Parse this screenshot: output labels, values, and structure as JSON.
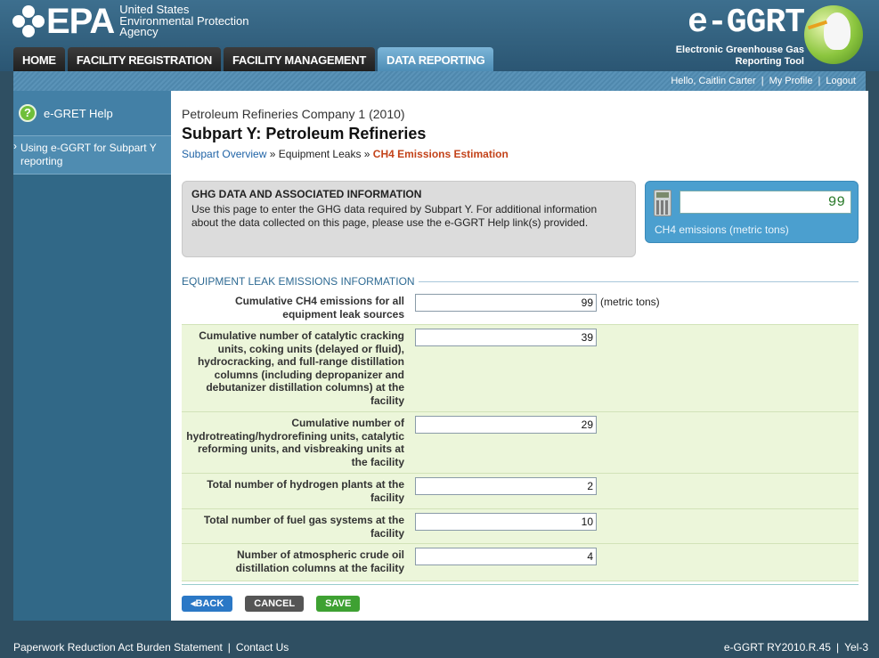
{
  "header": {
    "epa_word": "EPA",
    "agency_lines": [
      "United States",
      "Environmental Protection",
      "Agency"
    ],
    "eggrt_word": "e-GGRT",
    "eggrt_sub": [
      "Electronic Greenhouse Gas",
      "Reporting Tool"
    ]
  },
  "nav": {
    "tabs": [
      {
        "label": "HOME",
        "active": false
      },
      {
        "label": "FACILITY REGISTRATION",
        "active": false
      },
      {
        "label": "FACILITY MANAGEMENT",
        "active": false
      },
      {
        "label": "DATA REPORTING",
        "active": true
      }
    ]
  },
  "userbar": {
    "greeting": "Hello, Caitlin Carter",
    "profile": "My Profile",
    "logout": "Logout",
    "separator": "|"
  },
  "sidebar": {
    "help_title": "e-GRET Help",
    "help_link": "Using e-GGRT for Subpart Y reporting"
  },
  "main": {
    "company": "Petroleum Refineries Company 1 (2010)",
    "title": "Subpart Y: Petroleum Refineries",
    "breadcrumb": {
      "link1": "Subpart Overview",
      "sep": " » ",
      "item2": "Equipment Leaks",
      "current": "CH4 Emissions Estimation"
    },
    "info": {
      "title": "GHG DATA AND ASSOCIATED INFORMATION",
      "text": "Use this page to enter the GHG data required by Subpart Y. For additional information about the data collected on this page, please use the e-GGRT Help link(s) provided."
    },
    "calc": {
      "value": "99",
      "label": "CH4 emissions (metric tons)"
    },
    "section_title": "EQUIPMENT LEAK EMISSIONS INFORMATION",
    "rows": [
      {
        "label": "Cumulative CH4 emissions for all equipment leak sources",
        "value": "99",
        "unit": "(metric tons)"
      },
      {
        "label": "Cumulative number of catalytic cracking units, coking units (delayed or fluid), hydrocracking, and full-range distillation columns (including depropanizer and debutanizer distillation columns) at the facility",
        "value": "39",
        "unit": ""
      },
      {
        "label": "Cumulative number of hydrotreating/hydrorefining units, catalytic reforming units, and visbreaking units at the facility",
        "value": "29",
        "unit": ""
      },
      {
        "label": "Total number of hydrogen plants at the facility",
        "value": "2",
        "unit": ""
      },
      {
        "label": "Total number of fuel gas systems at the facility",
        "value": "10",
        "unit": ""
      },
      {
        "label": "Number of atmospheric crude oil distillation columns at the facility",
        "value": "4",
        "unit": ""
      }
    ],
    "buttons": {
      "back": "◂BACK",
      "cancel": "CANCEL",
      "save": "SAVE"
    }
  },
  "footer": {
    "paperwork": "Paperwork Reduction Act Burden Statement",
    "contact": "Contact Us",
    "version": "e-GGRT RY2010.R.45",
    "page_id": "Yel-3",
    "separator": "|"
  }
}
